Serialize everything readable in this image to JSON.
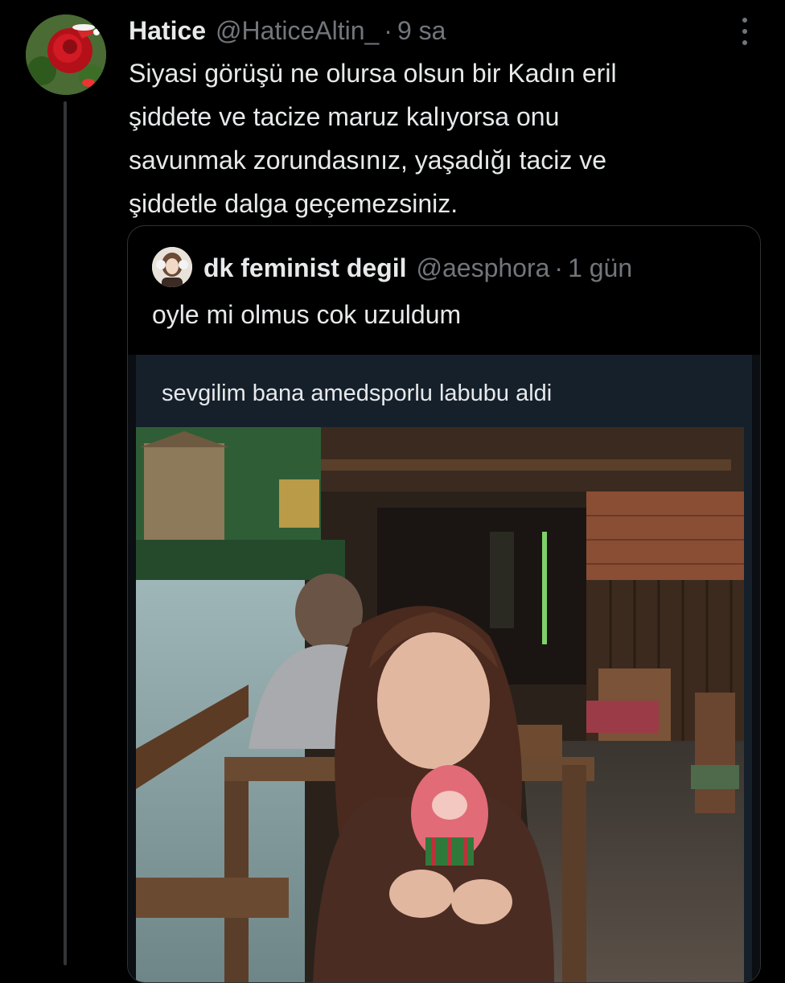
{
  "tweet": {
    "author_name": "Hatice",
    "author_handle": "@HaticeAltin_",
    "separator": "·",
    "time": "9 sa",
    "lines": [
      "Siyasi görüşü ne olursa olsun bir Kadın eril",
      "şiddete ve tacize maruz kalıyorsa onu",
      "savunmak zorundasınız, yaşadığı taciz ve",
      "şiddetle dalga geçemezsiniz."
    ]
  },
  "quote": {
    "author_name": "dk feminist degil",
    "author_handle": "@aesphora",
    "separator": "·",
    "time": "1 gün",
    "text": "oyle mi olmus cok uzuldum",
    "embedded": {
      "text": "sevgilim bana amedsporlu labubu aldi"
    }
  },
  "icons": {
    "more": "more-options-icon",
    "avatar": "rose-avatar",
    "quote_avatar": "person-avatar"
  },
  "colors": {
    "background": "#000000",
    "text_primary": "#e7e9ea",
    "text_secondary": "#71767b",
    "border": "#2f3336",
    "embedded_bg": "#15202b"
  }
}
